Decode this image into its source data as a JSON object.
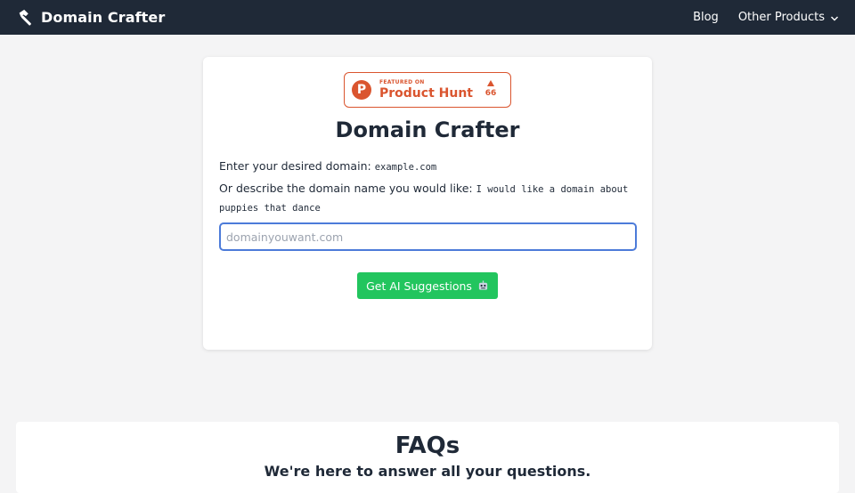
{
  "navbar": {
    "brand": "Domain Crafter",
    "brand_icon": "hammer-icon",
    "links": [
      {
        "label": "Blog"
      },
      {
        "label": "Other Products",
        "icon": "chevron-down-icon"
      }
    ],
    "bg_color": "#1f2937"
  },
  "product_hunt": {
    "featured_label": "FEATURED ON",
    "name": "Product Hunt",
    "logo_letter": "P",
    "votes": "66",
    "color": "#da552f"
  },
  "main": {
    "title": "Domain Crafter",
    "instruction_1": "Enter your desired domain:",
    "example_1": "example.com",
    "instruction_2": "Or describe the domain name you would like:",
    "example_2": "I would like a domain about puppies that dance",
    "input": {
      "value": "",
      "placeholder": "domainyouwant.com"
    },
    "button_label": "Get AI Suggestions",
    "button_icon": "robot-icon",
    "button_color": "#22c55e",
    "input_border_color": "#4c7bd9"
  },
  "faq": {
    "title": "FAQs",
    "subtitle": "We're here to answer all your questions."
  }
}
